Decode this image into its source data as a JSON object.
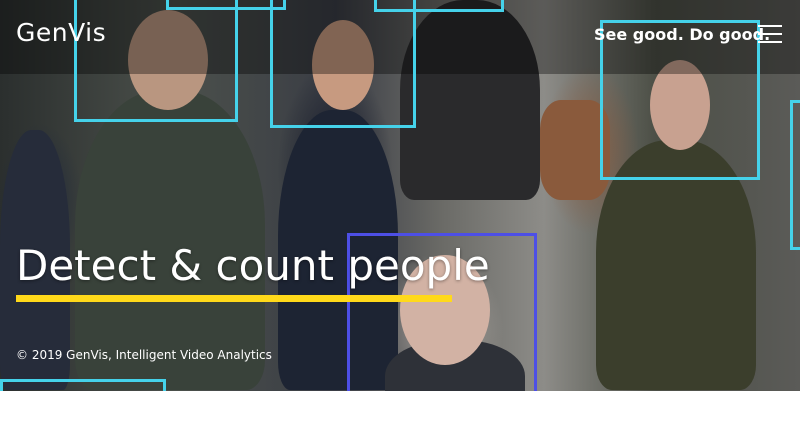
{
  "header": {
    "logo": "GenVis",
    "tagline": "See good. Do good.",
    "menu_icon": "hamburger-menu-icon"
  },
  "hero": {
    "headline": "Detect & count people",
    "copyright": "© 2019 GenVis, Intelligent Video Analytics",
    "accent_color": "#ffd91a",
    "detection_colors": {
      "primary": "#45d2ea",
      "highlight": "#4d4fe6"
    }
  }
}
